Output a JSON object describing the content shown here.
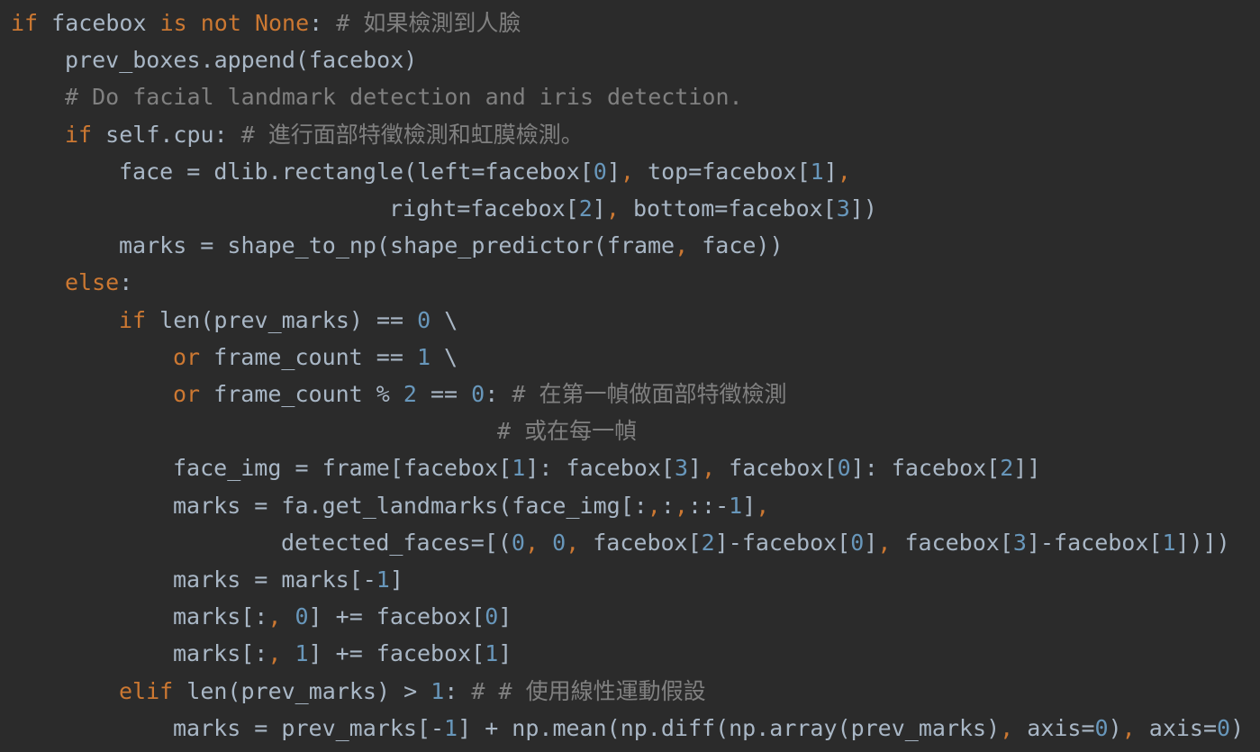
{
  "editor": {
    "language": "python",
    "theme": "dark",
    "colors": {
      "background": "#2b2b2b",
      "text": "#a9b7c6",
      "keyword": "#cc7832",
      "number": "#6897bb",
      "comment": "#808080",
      "punct": "#cc7832"
    },
    "lines": [
      {
        "indent": 0,
        "tokens": [
          {
            "t": "kw",
            "v": "if"
          },
          {
            "t": "tx",
            "v": " facebox "
          },
          {
            "t": "kw",
            "v": "is not"
          },
          {
            "t": "tx",
            "v": " "
          },
          {
            "t": "kw",
            "v": "None"
          },
          {
            "t": "tx",
            "v": ": "
          },
          {
            "t": "cm",
            "v": "# 如果檢測到人臉"
          }
        ]
      },
      {
        "indent": 4,
        "tokens": [
          {
            "t": "tx",
            "v": "prev_boxes.append(facebox)"
          }
        ]
      },
      {
        "indent": 4,
        "tokens": [
          {
            "t": "cm",
            "v": "# Do facial landmark detection and iris detection."
          }
        ]
      },
      {
        "indent": 4,
        "tokens": [
          {
            "t": "kw",
            "v": "if"
          },
          {
            "t": "tx",
            "v": " self.cpu: "
          },
          {
            "t": "cm",
            "v": "# 進行面部特徵檢測和虹膜檢測。"
          }
        ]
      },
      {
        "indent": 8,
        "tokens": [
          {
            "t": "tx",
            "v": "face = dlib.rectangle(left=facebox["
          },
          {
            "t": "num",
            "v": "0"
          },
          {
            "t": "tx",
            "v": "]"
          },
          {
            "t": "pn",
            "v": ","
          },
          {
            "t": "tx",
            "v": " top=facebox["
          },
          {
            "t": "num",
            "v": "1"
          },
          {
            "t": "tx",
            "v": "]"
          },
          {
            "t": "pn",
            "v": ","
          }
        ]
      },
      {
        "indent": 28,
        "tokens": [
          {
            "t": "tx",
            "v": "right=facebox["
          },
          {
            "t": "num",
            "v": "2"
          },
          {
            "t": "tx",
            "v": "]"
          },
          {
            "t": "pn",
            "v": ","
          },
          {
            "t": "tx",
            "v": " bottom=facebox["
          },
          {
            "t": "num",
            "v": "3"
          },
          {
            "t": "tx",
            "v": "])"
          }
        ]
      },
      {
        "indent": 8,
        "tokens": [
          {
            "t": "tx",
            "v": "marks = shape_to_np(shape_predictor(frame"
          },
          {
            "t": "pn",
            "v": ","
          },
          {
            "t": "tx",
            "v": " face))"
          }
        ]
      },
      {
        "indent": 4,
        "tokens": [
          {
            "t": "kw",
            "v": "else"
          },
          {
            "t": "tx",
            "v": ":"
          }
        ]
      },
      {
        "indent": 8,
        "tokens": [
          {
            "t": "kw",
            "v": "if"
          },
          {
            "t": "tx",
            "v": " len(prev_marks) == "
          },
          {
            "t": "num",
            "v": "0"
          },
          {
            "t": "tx",
            "v": " \\"
          }
        ]
      },
      {
        "indent": 12,
        "tokens": [
          {
            "t": "kw",
            "v": "or"
          },
          {
            "t": "tx",
            "v": " frame_count == "
          },
          {
            "t": "num",
            "v": "1"
          },
          {
            "t": "tx",
            "v": " \\"
          }
        ]
      },
      {
        "indent": 12,
        "tokens": [
          {
            "t": "kw",
            "v": "or"
          },
          {
            "t": "tx",
            "v": " frame_count % "
          },
          {
            "t": "num",
            "v": "2"
          },
          {
            "t": "tx",
            "v": " == "
          },
          {
            "t": "num",
            "v": "0"
          },
          {
            "t": "tx",
            "v": ": "
          },
          {
            "t": "cm",
            "v": "# 在第一幀做面部特徵檢測"
          }
        ]
      },
      {
        "indent": 36,
        "tokens": [
          {
            "t": "cm",
            "v": "# 或在每一幀"
          }
        ]
      },
      {
        "indent": 12,
        "tokens": [
          {
            "t": "tx",
            "v": "face_img = frame[facebox["
          },
          {
            "t": "num",
            "v": "1"
          },
          {
            "t": "tx",
            "v": "]: facebox["
          },
          {
            "t": "num",
            "v": "3"
          },
          {
            "t": "tx",
            "v": "]"
          },
          {
            "t": "pn",
            "v": ","
          },
          {
            "t": "tx",
            "v": " facebox["
          },
          {
            "t": "num",
            "v": "0"
          },
          {
            "t": "tx",
            "v": "]: facebox["
          },
          {
            "t": "num",
            "v": "2"
          },
          {
            "t": "tx",
            "v": "]]"
          }
        ]
      },
      {
        "indent": 12,
        "tokens": [
          {
            "t": "tx",
            "v": "marks = fa.get_landmarks(face_img[:"
          },
          {
            "t": "pn",
            "v": ","
          },
          {
            "t": "tx",
            "v": ":"
          },
          {
            "t": "pn",
            "v": ","
          },
          {
            "t": "tx",
            "v": "::-"
          },
          {
            "t": "num",
            "v": "1"
          },
          {
            "t": "tx",
            "v": "]"
          },
          {
            "t": "pn",
            "v": ","
          }
        ]
      },
      {
        "indent": 20,
        "tokens": [
          {
            "t": "tx",
            "v": "detected_faces=[("
          },
          {
            "t": "num",
            "v": "0"
          },
          {
            "t": "pn",
            "v": ","
          },
          {
            "t": "tx",
            "v": " "
          },
          {
            "t": "num",
            "v": "0"
          },
          {
            "t": "pn",
            "v": ","
          },
          {
            "t": "tx",
            "v": " facebox["
          },
          {
            "t": "num",
            "v": "2"
          },
          {
            "t": "tx",
            "v": "]-facebox["
          },
          {
            "t": "num",
            "v": "0"
          },
          {
            "t": "tx",
            "v": "]"
          },
          {
            "t": "pn",
            "v": ","
          },
          {
            "t": "tx",
            "v": " facebox["
          },
          {
            "t": "num",
            "v": "3"
          },
          {
            "t": "tx",
            "v": "]-facebox["
          },
          {
            "t": "num",
            "v": "1"
          },
          {
            "t": "tx",
            "v": "])])"
          }
        ]
      },
      {
        "indent": 12,
        "tokens": [
          {
            "t": "tx",
            "v": "marks = marks[-"
          },
          {
            "t": "num",
            "v": "1"
          },
          {
            "t": "tx",
            "v": "]"
          }
        ]
      },
      {
        "indent": 12,
        "tokens": [
          {
            "t": "tx",
            "v": "marks[:"
          },
          {
            "t": "pn",
            "v": ","
          },
          {
            "t": "tx",
            "v": " "
          },
          {
            "t": "num",
            "v": "0"
          },
          {
            "t": "tx",
            "v": "] += facebox["
          },
          {
            "t": "num",
            "v": "0"
          },
          {
            "t": "tx",
            "v": "]"
          }
        ]
      },
      {
        "indent": 12,
        "tokens": [
          {
            "t": "tx",
            "v": "marks[:"
          },
          {
            "t": "pn",
            "v": ","
          },
          {
            "t": "tx",
            "v": " "
          },
          {
            "t": "num",
            "v": "1"
          },
          {
            "t": "tx",
            "v": "] += facebox["
          },
          {
            "t": "num",
            "v": "1"
          },
          {
            "t": "tx",
            "v": "]"
          }
        ]
      },
      {
        "indent": 8,
        "tokens": [
          {
            "t": "kw",
            "v": "elif"
          },
          {
            "t": "tx",
            "v": " len(prev_marks) > "
          },
          {
            "t": "num",
            "v": "1"
          },
          {
            "t": "tx",
            "v": ": "
          },
          {
            "t": "cm",
            "v": "# # 使用線性運動假設"
          }
        ]
      },
      {
        "indent": 12,
        "tokens": [
          {
            "t": "tx",
            "v": "marks = prev_marks[-"
          },
          {
            "t": "num",
            "v": "1"
          },
          {
            "t": "tx",
            "v": "] + np.mean(np.diff(np.array(prev_marks)"
          },
          {
            "t": "pn",
            "v": ","
          },
          {
            "t": "tx",
            "v": " axis="
          },
          {
            "t": "num",
            "v": "0"
          },
          {
            "t": "tx",
            "v": ")"
          },
          {
            "t": "pn",
            "v": ","
          },
          {
            "t": "tx",
            "v": " axis="
          },
          {
            "t": "num",
            "v": "0"
          },
          {
            "t": "tx",
            "v": ")"
          }
        ]
      }
    ]
  }
}
